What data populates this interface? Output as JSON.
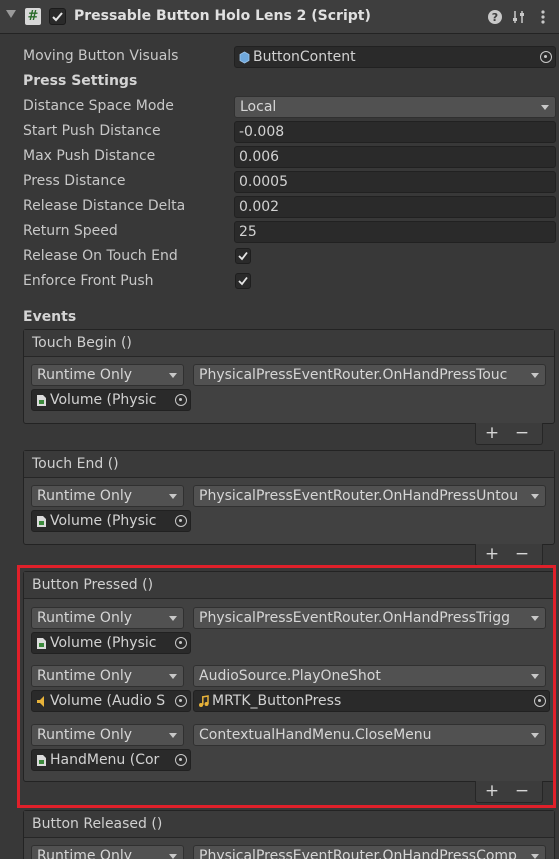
{
  "header": {
    "title": "Pressable Button Holo Lens 2 (Script)",
    "script_glyph": "#"
  },
  "fields": {
    "moving_button_visuals": {
      "label": "Moving Button Visuals",
      "value": "ButtonContent"
    },
    "press_settings_label": "Press Settings",
    "distance_space_mode": {
      "label": "Distance Space Mode",
      "value": "Local"
    },
    "start_push_distance": {
      "label": "Start Push Distance",
      "value": "-0.008"
    },
    "max_push_distance": {
      "label": "Max Push Distance",
      "value": "0.006"
    },
    "press_distance": {
      "label": "Press Distance",
      "value": "0.0005"
    },
    "release_distance_delta": {
      "label": "Release Distance Delta",
      "value": "0.002"
    },
    "return_speed": {
      "label": "Return Speed",
      "value": "25"
    },
    "release_on_touch_end": {
      "label": "Release On Touch End",
      "checked": true
    },
    "enforce_front_push": {
      "label": "Enforce Front Push",
      "checked": true
    }
  },
  "events_label": "Events",
  "events": {
    "touch_begin": {
      "title": "Touch Begin ()",
      "mode": "Runtime Only",
      "function": "PhysicalPressEventRouter.OnHandPressTouc",
      "object": "Volume (Physic"
    },
    "touch_end": {
      "title": "Touch End ()",
      "mode": "Runtime Only",
      "function": "PhysicalPressEventRouter.OnHandPressUntou",
      "object": "Volume (Physic"
    },
    "button_pressed": {
      "title": "Button Pressed ()",
      "listeners": [
        {
          "mode": "Runtime Only",
          "function": "PhysicalPressEventRouter.OnHandPressTrigg",
          "object": "Volume (Physic"
        },
        {
          "mode": "Runtime Only",
          "function": "AudioSource.PlayOneShot",
          "object": "Volume (Audio S",
          "argument": "MRTK_ButtonPress"
        },
        {
          "mode": "Runtime Only",
          "function": "ContextualHandMenu.CloseMenu",
          "object": "HandMenu (Cor"
        }
      ]
    },
    "button_released": {
      "title": "Button Released ()",
      "mode": "Runtime Only",
      "function": "PhysicalPressEventRouter.OnHandPressComp"
    }
  },
  "buttons": {
    "plus": "+",
    "minus": "−"
  },
  "colors": {
    "highlight": "#e0202a",
    "background": "#383838"
  }
}
